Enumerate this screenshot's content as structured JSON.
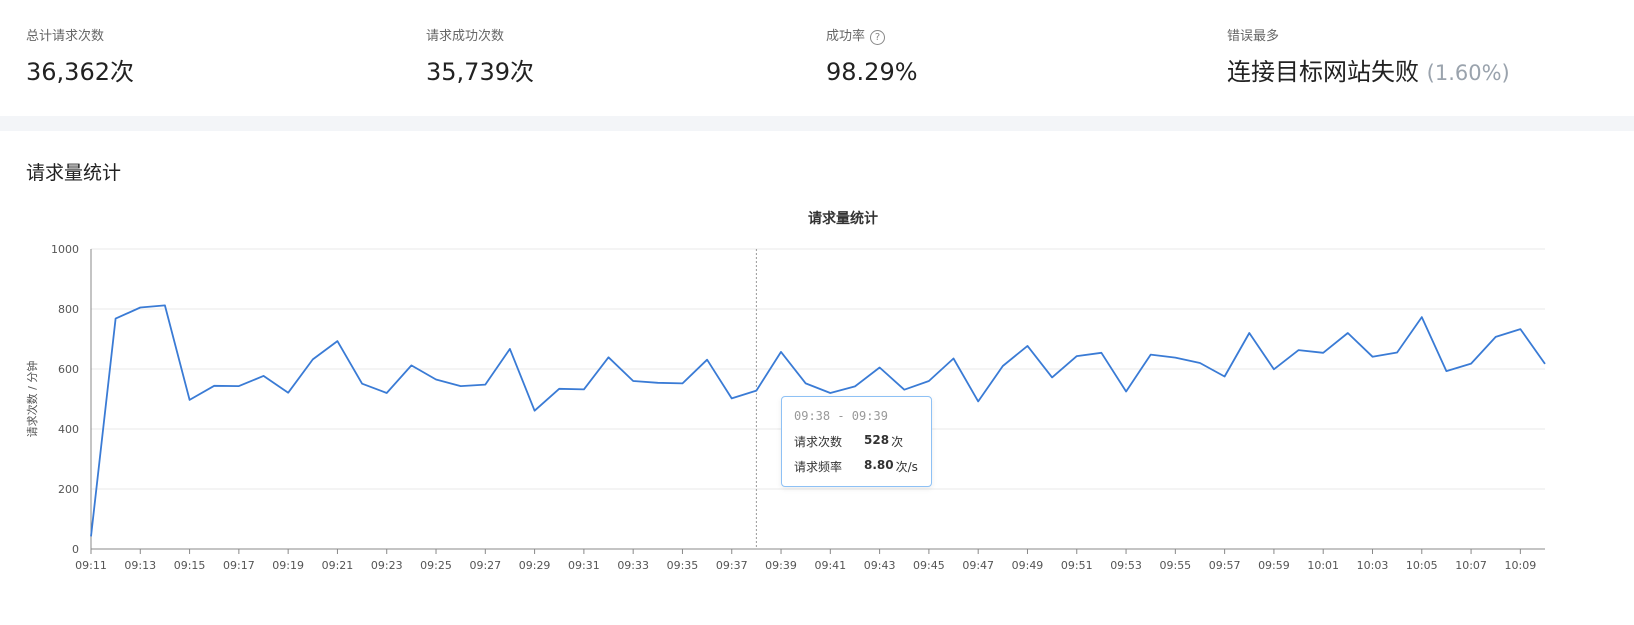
{
  "stats": [
    {
      "label": "总计请求次数",
      "value": "36,362次",
      "sub": "",
      "help": false
    },
    {
      "label": "请求成功次数",
      "value": "35,739次",
      "sub": "",
      "help": false
    },
    {
      "label": "成功率",
      "value": "98.29%",
      "sub": "",
      "help": true
    },
    {
      "label": "错误最多",
      "value": "连接目标网站失败",
      "sub": "(1.60%)",
      "help": false
    }
  ],
  "section_title": "请求量统计",
  "help_glyph": "?",
  "tooltip": {
    "range": "09:38 - 09:39",
    "rows": [
      {
        "label": "请求次数",
        "value": "528",
        "unit": "次"
      },
      {
        "label": "请求频率",
        "value": "8.80",
        "unit": "次/s"
      }
    ]
  },
  "colors": {
    "line": "#3a7bd5",
    "grid": "#e9e9e9",
    "axis": "#888888",
    "tooltip_border": "#8ec1f5"
  },
  "chart_data": {
    "type": "line",
    "title": "请求量统计",
    "ylabel": "请求次数 / 分钟",
    "xlabel": "",
    "ylim": [
      0,
      1000
    ],
    "yticks": [
      0,
      200,
      400,
      600,
      800,
      1000
    ],
    "x": [
      "09:11",
      "09:12",
      "09:13",
      "09:14",
      "09:15",
      "09:16",
      "09:17",
      "09:18",
      "09:19",
      "09:20",
      "09:21",
      "09:22",
      "09:23",
      "09:24",
      "09:25",
      "09:26",
      "09:27",
      "09:28",
      "09:29",
      "09:30",
      "09:31",
      "09:32",
      "09:33",
      "09:34",
      "09:35",
      "09:36",
      "09:37",
      "09:38",
      "09:39",
      "09:40",
      "09:41",
      "09:42",
      "09:43",
      "09:44",
      "09:45",
      "09:46",
      "09:47",
      "09:48",
      "09:49",
      "09:50",
      "09:51",
      "09:52",
      "09:53",
      "09:54",
      "09:55",
      "09:56",
      "09:57",
      "09:58",
      "09:59",
      "10:00",
      "10:01",
      "10:02",
      "10:03",
      "10:04",
      "10:05",
      "10:06",
      "10:07",
      "10:08",
      "10:09",
      "10:10"
    ],
    "xtick_labels": [
      "09:11",
      "09:13",
      "09:15",
      "09:17",
      "09:19",
      "09:21",
      "09:23",
      "09:25",
      "09:27",
      "09:29",
      "09:31",
      "09:33",
      "09:35",
      "09:37",
      "09:39",
      "09:41",
      "09:43",
      "09:45",
      "09:47",
      "09:49",
      "09:51",
      "09:53",
      "09:55",
      "09:57",
      "09:59",
      "10:01",
      "10:03",
      "10:05",
      "10:07",
      "10:09"
    ],
    "series": [
      {
        "values": [
          42,
          768,
          805,
          812,
          497,
          544,
          543,
          577,
          521,
          632,
          693,
          551,
          520,
          612,
          565,
          543,
          548,
          667,
          461,
          534,
          532,
          639,
          560,
          554,
          552,
          631,
          502,
          528,
          657,
          552,
          520,
          542,
          605,
          531,
          560,
          635,
          492,
          610,
          677,
          572,
          643,
          654,
          525,
          648,
          638,
          620,
          575,
          720,
          599,
          663,
          654,
          720,
          641,
          655,
          773,
          593,
          618,
          707,
          733,
          617
        ]
      }
    ],
    "highlight_x": "09:38",
    "grid": true,
    "legend": "none"
  }
}
